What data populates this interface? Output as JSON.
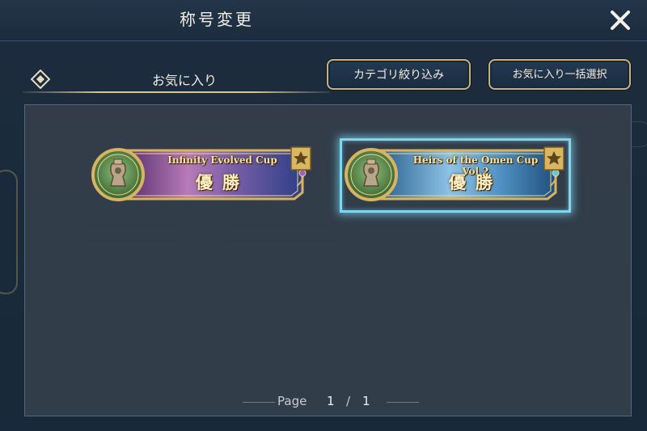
{
  "header": {
    "title": "称号変更",
    "close_icon": "close-icon"
  },
  "tab": {
    "label": "お気に入り",
    "icon": "diamond-icon"
  },
  "toolbar": {
    "filter_label": "カテゴリ絞り込み",
    "bulk_select_label": "お気に入り一括選択"
  },
  "titles": [
    {
      "name": "Infinity Evolved Cup",
      "rank": "優勝",
      "favorite": true,
      "selected": false,
      "trophy_icon": "trophy-emblem-icon",
      "theme": "purple"
    },
    {
      "name": "Heirs of the Omen Cup Vol.2",
      "rank": "優勝",
      "favorite": true,
      "selected": true,
      "trophy_icon": "trophy-emblem-icon",
      "theme": "blue"
    }
  ],
  "pager": {
    "label": "Page",
    "current": "1",
    "separator": "/",
    "total": "1"
  },
  "colors": {
    "gold": "#c9b27a",
    "selection": "#7fd6ee",
    "panel": "#343e4a"
  }
}
